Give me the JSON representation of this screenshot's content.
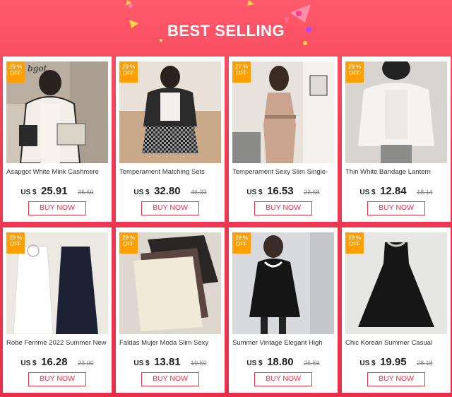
{
  "header": {
    "title": "BEST SELLING"
  },
  "products": [
    {
      "badge_pct": "29 %",
      "badge_off": "OFF",
      "name": "Asapgot White Mink Cashmere",
      "currency": "US $",
      "price": "25.91",
      "old_price": "36.60",
      "button": "BUY NOW",
      "photo_overlay_text": "bgot",
      "palette": [
        "#cfc5b8",
        "#f4efe6",
        "#2a2a2a"
      ]
    },
    {
      "badge_pct": "29 %",
      "badge_off": "OFF",
      "name": "Temperament Matching Sets",
      "currency": "US $",
      "price": "32.80",
      "old_price": "46.33",
      "button": "BUY NOW",
      "palette": [
        "#e9e1d8",
        "#9a9a9a",
        "#2b2b2b"
      ]
    },
    {
      "badge_pct": "27 %",
      "badge_off": "OFF",
      "name": "Temperament Sexy Slim Single-",
      "currency": "US $",
      "price": "16.53",
      "old_price": "22.68",
      "button": "BUY NOW",
      "palette": [
        "#e8e2dc",
        "#caa48f",
        "#3a2a22"
      ]
    },
    {
      "badge_pct": "29 %",
      "badge_off": "OFF",
      "name": "Thin White Bandage Lantern",
      "currency": "US $",
      "price": "12.84",
      "old_price": "18.14",
      "button": "BUY NOW",
      "palette": [
        "#d8d5d0",
        "#f5f3ef",
        "#222222"
      ]
    },
    {
      "badge_pct": "29 %",
      "badge_off": "OFF",
      "name": "Robe Femme 2022 Summer New",
      "currency": "US $",
      "price": "16.28",
      "old_price": "23.00",
      "button": "BUY NOW",
      "palette": [
        "#ece8e2",
        "#ffffff",
        "#1c2233"
      ]
    },
    {
      "badge_pct": "29 %",
      "badge_off": "OFF",
      "name": "Faldas Mujer Moda Slim Sexy",
      "currency": "US $",
      "price": "13.81",
      "old_price": "19.50",
      "button": "BUY NOW",
      "palette": [
        "#ddd7cf",
        "#f1ead9",
        "#2a2626"
      ]
    },
    {
      "badge_pct": "29 %",
      "badge_off": "OFF",
      "name": "Summer Vintage Elegant High",
      "currency": "US $",
      "price": "18.80",
      "old_price": "26.56",
      "button": "BUY NOW",
      "palette": [
        "#d7d9dc",
        "#fafafa",
        "#151515"
      ]
    },
    {
      "badge_pct": "29 %",
      "badge_off": "OFF",
      "name": "Chic Korean Summer Casual",
      "currency": "US $",
      "price": "19.95",
      "old_price": "28.18",
      "button": "BUY NOW",
      "palette": [
        "#e6e6e4",
        "#cfcfcd",
        "#161616"
      ]
    }
  ],
  "colors": {
    "accent": "#e8304b",
    "badge": "#ff9f00",
    "background": "#f03a55"
  }
}
